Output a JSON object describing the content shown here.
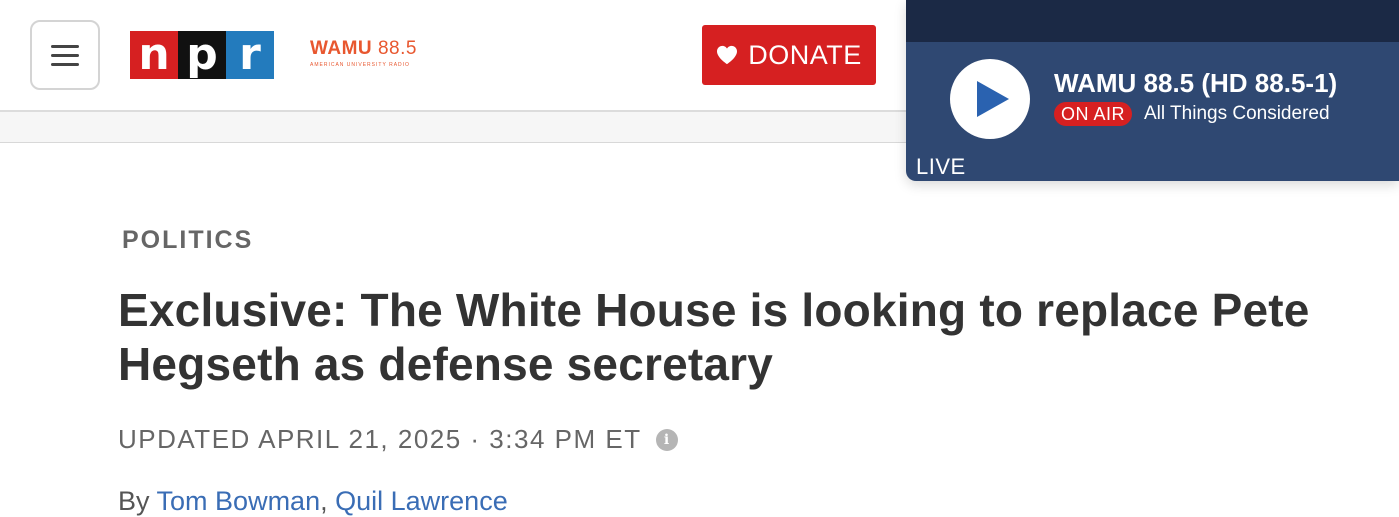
{
  "header": {
    "menu_icon": "hamburger-menu-icon",
    "npr_logo_letters": [
      "n",
      "p",
      "r"
    ],
    "wamu_logo": {
      "name": "WAMU",
      "frequency": "88.5",
      "tagline": "AMERICAN UNIVERSITY RADIO"
    },
    "donate": {
      "icon": "heart-icon",
      "label": "DONATE"
    }
  },
  "player": {
    "station": "WAMU 88.5 (HD 88.5-1)",
    "status_badge": "ON AIR",
    "program": "All Things Considered",
    "live_label": "LIVE",
    "play_icon": "play-icon"
  },
  "article": {
    "section": "POLITICS",
    "headline": "Exclusive: The White House is looking to replace Pete Hegseth as defense secretary",
    "dateline": "UPDATED APRIL 21, 2025 · 3:34 PM ET",
    "info_icon": "info-icon",
    "byline_prefix": "By",
    "authors": [
      "Tom Bowman",
      "Quil Lawrence"
    ],
    "author_separator": ","
  },
  "colors": {
    "npr_red": "#d62021",
    "npr_black": "#111111",
    "npr_blue": "#237bbd",
    "wamu_orange": "#e8572f",
    "player_dark": "#1b2945",
    "player_body": "#2f4872",
    "link_blue": "#3a6db5"
  }
}
